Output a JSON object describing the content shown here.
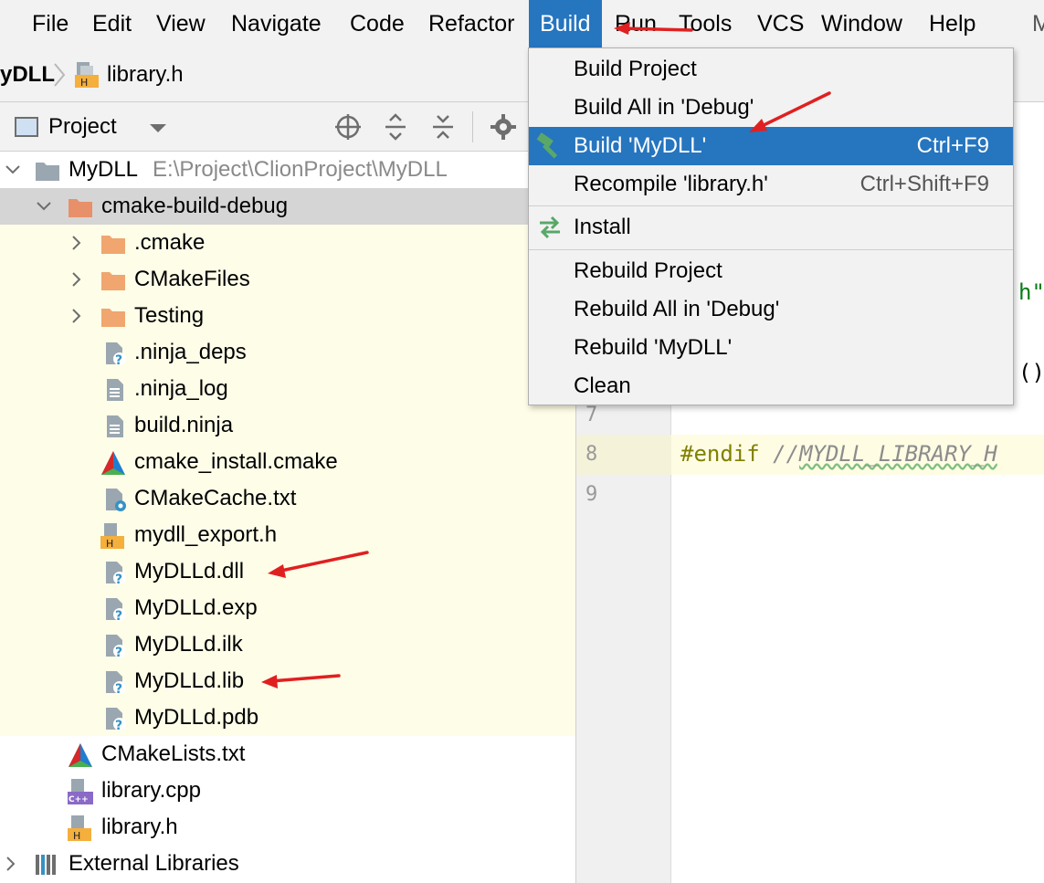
{
  "menubar": {
    "items": [
      "File",
      "Edit",
      "View",
      "Navigate",
      "Code",
      "Refactor",
      "Build",
      "Run",
      "Tools",
      "VCS",
      "Window",
      "Help"
    ],
    "active": "Build",
    "edge_text": "M"
  },
  "breadcrumb": {
    "project": "yDLL",
    "file": "library.h"
  },
  "tool_window": {
    "title": "Project"
  },
  "tree": {
    "root": {
      "label": "MyDLL",
      "path": "E:\\Project\\ClionProject\\MyDLL"
    },
    "build_dir": "cmake-build-debug",
    "items": [
      {
        "label": ".cmake",
        "type": "folder"
      },
      {
        "label": "CMakeFiles",
        "type": "folder"
      },
      {
        "label": "Testing",
        "type": "folder"
      },
      {
        "label": ".ninja_deps",
        "type": "unknown-file"
      },
      {
        "label": ".ninja_log",
        "type": "text-file"
      },
      {
        "label": "build.ninja",
        "type": "text-file"
      },
      {
        "label": "cmake_install.cmake",
        "type": "cmake-file"
      },
      {
        "label": "CMakeCache.txt",
        "type": "config-file"
      },
      {
        "label": "mydll_export.h",
        "type": "header-file"
      },
      {
        "label": "MyDLLd.dll",
        "type": "unknown-file"
      },
      {
        "label": "MyDLLd.exp",
        "type": "unknown-file"
      },
      {
        "label": "MyDLLd.ilk",
        "type": "unknown-file"
      },
      {
        "label": "MyDLLd.lib",
        "type": "unknown-file"
      },
      {
        "label": "MyDLLd.pdb",
        "type": "unknown-file"
      }
    ],
    "root_files": [
      {
        "label": "CMakeLists.txt",
        "type": "cmake-file"
      },
      {
        "label": "library.cpp",
        "type": "cpp-file",
        "badge": "C++"
      },
      {
        "label": "library.h",
        "type": "header-file",
        "badge": "H"
      }
    ],
    "external": "External Libraries"
  },
  "editor": {
    "line_numbers": [
      "7",
      "8",
      "9"
    ],
    "fragments": [
      "h\"",
      "()"
    ],
    "line8": {
      "keyword": "#endif",
      "comment_prefix": "//",
      "comment_text": "MYDLL_LIBRARY_H"
    }
  },
  "build_menu": {
    "items": [
      {
        "label": "Build Project",
        "shortcut": ""
      },
      {
        "label": "Build All in 'Debug'",
        "shortcut": ""
      },
      {
        "label": "Build 'MyDLL'",
        "shortcut": "Ctrl+F9"
      },
      {
        "label": "Recompile 'library.h'",
        "shortcut": "Ctrl+Shift+F9"
      },
      {
        "label": "Install",
        "shortcut": ""
      },
      {
        "label": "Rebuild Project",
        "shortcut": ""
      },
      {
        "label": "Rebuild All in 'Debug'",
        "shortcut": ""
      },
      {
        "label": "Rebuild 'MyDLL'",
        "shortcut": ""
      },
      {
        "label": "Clean",
        "shortcut": ""
      }
    ],
    "highlighted": "Build 'MyDLL'"
  },
  "colors": {
    "accent": "#2675bf",
    "annotation_arrow": "#e02020",
    "folder": "#f0a66e",
    "build_dir_folder": "#e8906a"
  }
}
